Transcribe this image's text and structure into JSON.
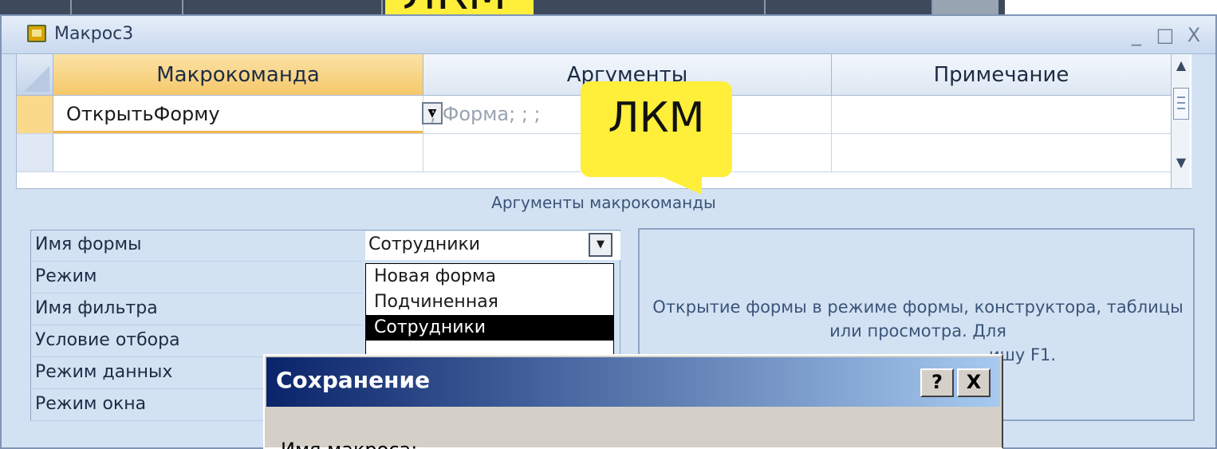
{
  "top_callout": {
    "text": "ЛКМ"
  },
  "window": {
    "title": "Макрос3",
    "minimize": "_",
    "maximize": "□",
    "close": "X"
  },
  "grid": {
    "headers": [
      "Макрокоманда",
      "Аргументы",
      "Примечание"
    ],
    "rows": [
      {
        "action": "ОткрытьФорму",
        "arguments": "; Форма; ; ;",
        "note": ""
      },
      {
        "action": "",
        "arguments": "",
        "note": ""
      }
    ]
  },
  "callout": {
    "text": "ЛКМ"
  },
  "args_section": {
    "title": "Аргументы макрокоманды",
    "labels": [
      "Имя формы",
      "Режим",
      "Имя фильтра",
      "Условие отбора",
      "Режим данных",
      "Режим окна"
    ],
    "form_name_value": "Сотрудники",
    "dropdown_options": [
      "Новая форма",
      "Подчиненная",
      "Сотрудники"
    ],
    "help_text": "Открытие формы в режиме формы, конструктора, таблицы или просмотра. Для ",
    "help_text_tail": "ишу F1."
  },
  "dialog": {
    "title": "Сохранение",
    "help_button": "?",
    "close_button": "X",
    "label": "Имя макроса:"
  }
}
